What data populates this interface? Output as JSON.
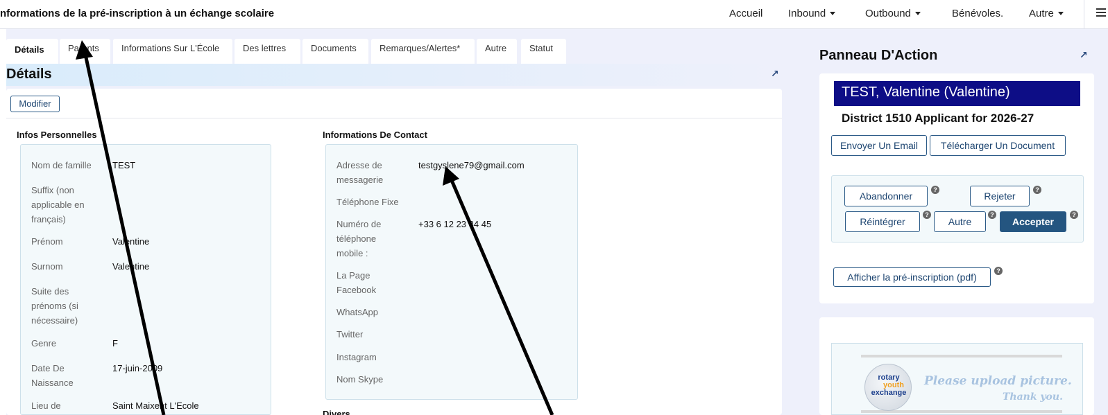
{
  "header": {
    "title": "nformations de la pré-inscription à un échange scolaire",
    "nav": {
      "home": "Accueil",
      "inbound": "Inbound",
      "outbound": "Outbound",
      "volunteers": "Bénévoles.",
      "other": "Autre"
    }
  },
  "tabs": [
    "Détails",
    "Parents",
    "Informations Sur L'École",
    "Des lettres",
    "Documents",
    "Remarques/Alertes*",
    "Autre",
    "Statut"
  ],
  "details": {
    "section_title": "Détails",
    "edit_label": "Modifier",
    "personal": {
      "heading": "Infos Personnelles",
      "fields": [
        {
          "label": "Nom de famille",
          "value": "TEST"
        },
        {
          "label": "Suffix (non applicable en français)",
          "value": ""
        },
        {
          "label": "Prénom",
          "value": "Valentine"
        },
        {
          "label": "Surnom",
          "value": "Valentine"
        },
        {
          "label": "Suite des prénoms (si nécessaire)",
          "value": ""
        },
        {
          "label": "Genre",
          "value": "F"
        },
        {
          "label": "Date De Naissance",
          "value": "17-juin-2009"
        },
        {
          "label": "Lieu de",
          "value": "Saint Maixent L'Ecole"
        }
      ]
    },
    "contact": {
      "heading": "Informations De Contact",
      "fields": [
        {
          "label": "Adresse de messagerie",
          "value": "testgyslene79@gmail.com"
        },
        {
          "label": "Téléphone Fixe",
          "value": ""
        },
        {
          "label": "Numéro de téléphone mobile :",
          "value": "+33 6 12 23 34 45"
        },
        {
          "label": "La Page Facebook",
          "value": ""
        },
        {
          "label": "WhatsApp",
          "value": ""
        },
        {
          "label": "Twitter",
          "value": ""
        },
        {
          "label": "Instagram",
          "value": ""
        },
        {
          "label": "Nom Skype",
          "value": ""
        }
      ]
    },
    "misc_heading": "Divers"
  },
  "panel": {
    "title": "Panneau D'Action",
    "student_name": "TEST, Valentine (Valentine)",
    "district": "District 1510 Applicant for 2026-27",
    "send_email": "Envoyer Un Email",
    "upload_document": "Télécharger Un Document",
    "abandon": "Abandonner",
    "reject": "Rejeter",
    "reinstate": "Réintégrer",
    "other": "Autre",
    "accept": "Accepter",
    "help_mark": "?",
    "view_pdf": "Afficher la pré-inscription (pdf)",
    "photo": {
      "logo_line1": "rotary",
      "logo_line2": "youth",
      "logo_line3": "exchange",
      "upload_line1": "Please upload picture.",
      "upload_line2": "Thank you."
    }
  },
  "colors": {
    "primary_button": "#245580",
    "name_bar": "#0d0d86",
    "info_box": "#f3f9fb"
  }
}
